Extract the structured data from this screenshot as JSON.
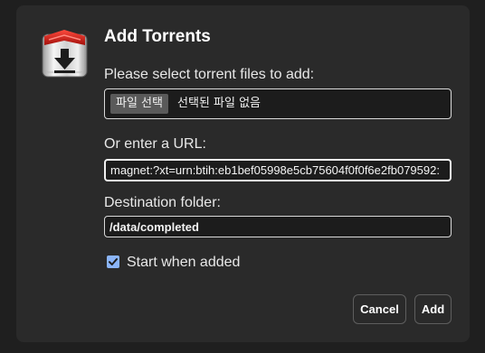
{
  "dialog": {
    "title": "Add Torrents",
    "icon": "transmission-app-icon"
  },
  "files": {
    "label": "Please select torrent files to add:",
    "button_label": "파일 선택",
    "status_text": "선택된 파일 없음"
  },
  "url": {
    "label": "Or enter a URL:",
    "value": "magnet:?xt=urn:btih:eb1bef05998e5cb75604f0f0f6e2fb079592:"
  },
  "destination": {
    "label": "Destination folder:",
    "value": "/data/completed"
  },
  "start_when_added": {
    "label": "Start when added",
    "checked": true
  },
  "buttons": {
    "cancel_label": "Cancel",
    "add_label": "Add"
  },
  "colors": {
    "dialog_bg": "#2a2a2a",
    "page_bg": "#1f1f1f",
    "checkbox_accent": "#8ab4f8"
  }
}
